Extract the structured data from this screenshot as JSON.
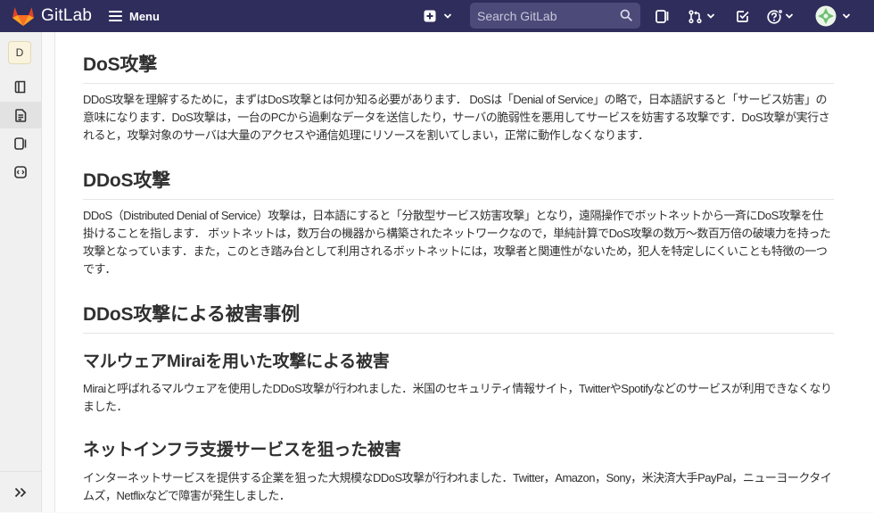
{
  "topbar": {
    "brand": "GitLab",
    "menu_label": "Menu",
    "search_placeholder": "Search GitLab"
  },
  "sidebar": {
    "project_initial": "D"
  },
  "doc": {
    "sections": [
      {
        "heading": "DoS攻撃",
        "paragraph": "DDoS攻撃を理解するために，まずはDoS攻撃とは何か知る必要があります． DoSは「Denial of Service」の略で，日本語訳すると「サービス妨害」の意味になります．DoS攻撃は，一台のPCから過剰なデータを送信したり，サーバの脆弱性を悪用してサービスを妨害する攻撃です．DoS攻撃が実行されると，攻撃対象のサーバは大量のアクセスや通信処理にリソースを割いてしまい，正常に動作しなくなります．"
      },
      {
        "heading": "DDoS攻撃",
        "paragraph": "DDoS（Distributed Denial of Service）攻撃は，日本語にすると「分散型サービス妨害攻撃」となり，遠隔操作でボットネットから一斉にDoS攻撃を仕掛けることを指します． ボットネットは，数万台の機器から構築されたネットワークなので，単純計算でDoS攻撃の数万〜数百万倍の破壊力を持った攻撃となっています．また，このとき踏み台として利用されるボットネットには，攻撃者と関連性がないため，犯人を特定しにくいことも特徴の一つです．"
      },
      {
        "heading": "DDoS攻撃による被害事例"
      }
    ],
    "subsections": [
      {
        "heading": "マルウェアMiraiを用いた攻撃による被害",
        "paragraph": "Miraiと呼ばれるマルウェアを使用したDDoS攻撃が行われました．米国のセキュリティ情報サイト，TwitterやSpotifyなどのサービスが利用できなくなりました．"
      },
      {
        "heading": "ネットインフラ支援サービスを狙った被害",
        "paragraph": "インターネットサービスを提供する企業を狙った大規模なDDoS攻撃が行われました．Twitter，Amazon，Sony，米決済大手PayPal，ニューヨークタイムズ，Netflixなどで障害が発生しました．"
      }
    ]
  }
}
